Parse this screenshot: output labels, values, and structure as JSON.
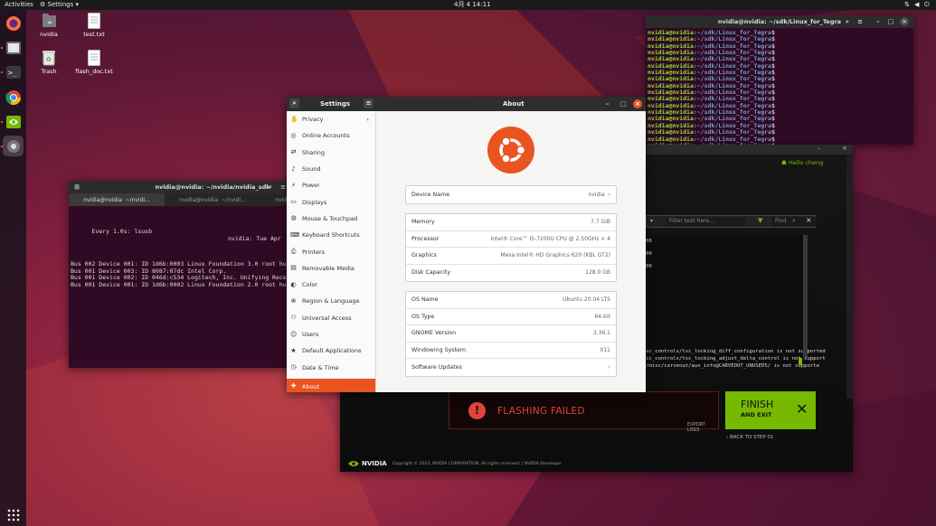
{
  "topbar": {
    "activities": "Activities",
    "app_menu": "Settings",
    "clock": "4月 4  14:11"
  },
  "desktop_icons": [
    {
      "label": "nvidia"
    },
    {
      "label": "test.txt"
    },
    {
      "label": "Trash"
    },
    {
      "label": "flash_doc.txt"
    }
  ],
  "terminal_right": {
    "title": "nvidia@nvidia: ~/sdk/Linux_for_Tegra",
    "prompt_user": "nvidia@nvidia",
    "prompt_dir": ":~/sdk/Linux_for_Tegra",
    "prompt_end": "$",
    "line_count": 18
  },
  "sdk_manager": {
    "user": "Hello cheng",
    "filter_placeholder": "Filter text here...",
    "find_placeholder": "Find",
    "log_lines": [
      "00",
      "00",
      "00",
      "sc_controls/tsc_locking_diff_configuration is not supported",
      "sc_controls/tsc_locking_adjust_delta_control is not support",
      "/misc/carveout/aux_info@CARVEOUT_UNUSED5/ is not supporte"
    ],
    "flashing_failed": "FLASHING FAILED",
    "export_logs": "EXPORT LOGS",
    "finish_line1": "FINISH",
    "finish_line2": "AND EXIT",
    "back": "BACK TO STEP 01",
    "brand": "NVIDIA",
    "copyright": "Copyright © 2023, NVIDIA CORPORATION. All rights reserved. | NVIDIA Developer",
    "colors": {
      "accent": "#76b900",
      "error": "#e0453a"
    }
  },
  "terminal_left": {
    "title": "nvidia@nvidia: ~/nvidia/nvidia_sdk",
    "tabs": [
      "nvidia@nvidia: ~/nvidi...",
      "nvidia@nvidia: ~/nvidi...",
      "nvidia@nvidia: ~/nvidi..."
    ],
    "header_left": "Every 1.0s: lsusb",
    "header_right": "nvidia: Tue Apr  4",
    "output": [
      "Bus 002 Device 001: ID 1d6b:0003 Linux Foundation 3.0 root hub",
      "Bus 001 Device 003: ID 8087:07dc Intel Corp.",
      "Bus 001 Device 002: ID 046d:c534 Logitech, Inc. Unifying Receiver",
      "Bus 001 Device 001: ID 1d6b:0002 Linux Foundation 2.0 root hub"
    ]
  },
  "settings": {
    "sidebar_title": "Settings",
    "panel_title": "About",
    "sidebar": [
      {
        "label": "Privacy",
        "icon": "privacy-icon",
        "glyph": "✋",
        "arrow": "›"
      },
      {
        "label": "Online Accounts",
        "icon": "online-accounts-icon",
        "glyph": "◎"
      },
      {
        "label": "Sharing",
        "icon": "sharing-icon",
        "glyph": "⇄"
      },
      {
        "label": "Sound",
        "icon": "sound-icon",
        "glyph": "♪"
      },
      {
        "label": "Power",
        "icon": "power-icon",
        "glyph": "⚡"
      },
      {
        "label": "Displays",
        "icon": "displays-icon",
        "glyph": "▭"
      },
      {
        "label": "Mouse & Touchpad",
        "icon": "mouse-icon",
        "glyph": "◍"
      },
      {
        "label": "Keyboard Shortcuts",
        "icon": "keyboard-icon",
        "glyph": "⌨"
      },
      {
        "label": "Printers",
        "icon": "printer-icon",
        "glyph": "⎙"
      },
      {
        "label": "Removable Media",
        "icon": "removable-media-icon",
        "glyph": "▤"
      },
      {
        "label": "Color",
        "icon": "color-icon",
        "glyph": "◐"
      },
      {
        "label": "Region & Language",
        "icon": "region-icon",
        "glyph": "⊕"
      },
      {
        "label": "Universal Access",
        "icon": "accessibility-icon",
        "glyph": "⚇"
      },
      {
        "label": "Users",
        "icon": "users-icon",
        "glyph": "☺"
      },
      {
        "label": "Default Applications",
        "icon": "default-apps-icon",
        "glyph": "★"
      },
      {
        "label": "Date & Time",
        "icon": "clock-icon",
        "glyph": "◷"
      },
      {
        "label": "About",
        "icon": "info-icon",
        "glyph": "✚",
        "selected": true
      }
    ],
    "device_name": {
      "label": "Device Name",
      "value": "nvidia"
    },
    "hardware": [
      {
        "label": "Memory",
        "value": "7.7 GiB"
      },
      {
        "label": "Processor",
        "value": "Intel® Core™ i5-7200U CPU @ 2.50GHz × 4"
      },
      {
        "label": "Graphics",
        "value": "Mesa Intel® HD Graphics 620 (KBL GT2)"
      },
      {
        "label": "Disk Capacity",
        "value": "128.0 GB"
      }
    ],
    "software": [
      {
        "label": "OS Name",
        "value": "Ubuntu 20.04 LTS"
      },
      {
        "label": "OS Type",
        "value": "64-bit"
      },
      {
        "label": "GNOME Version",
        "value": "3.36.1"
      },
      {
        "label": "Windowing System",
        "value": "X11"
      },
      {
        "label": "Software Updates",
        "value": "›"
      }
    ],
    "accent_color": "#e95420"
  }
}
